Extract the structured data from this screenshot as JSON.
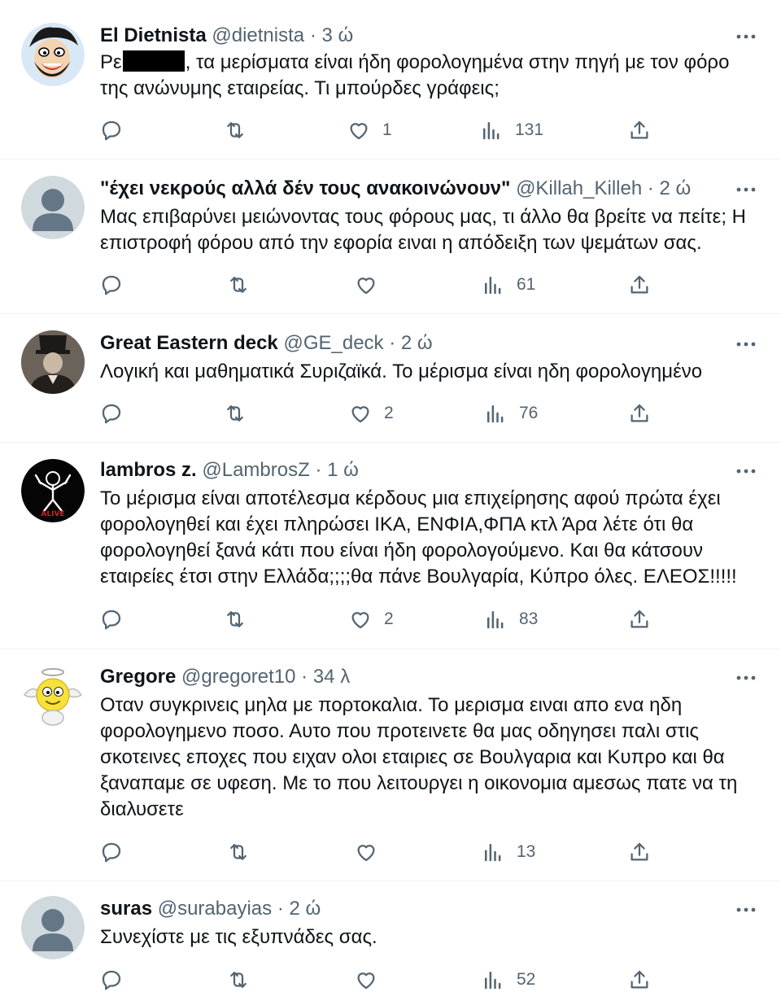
{
  "tweets": [
    {
      "name": "El Dietnista",
      "handle": "@dietnista",
      "time": "· 3 ώ",
      "text_before": "Ρε",
      "text_after": ", τα μερίσματα είναι ήδη φορολογημένα στην πηγή με τον φόρο της ανώνυμης εταιρείας. Τι μπούρδες γράφεις;",
      "likes": "1",
      "views": "131"
    },
    {
      "name": "\"έχει νεκρούς αλλά δέν τους ανακοινώνουν\"",
      "handle": "@Killah_Killeh",
      "time": "· 2 ώ",
      "text": "Μας επιβαρύνει μειώνοντας τους φόρους μας, τι άλλο θα βρείτε να πείτε; Η επιστροφή φόρου από την εφορία ειναι η απόδειξη των ψεμάτων σας.",
      "likes": "",
      "views": "61"
    },
    {
      "name": "Great Eastern deck",
      "handle": "@GE_deck",
      "time": "· 2 ώ",
      "text": "Λογική και μαθηματικά Συριζαϊκά. Το μέρισμα είναι ηδη φορολογημένο",
      "likes": "2",
      "views": "76"
    },
    {
      "name": "lambros z.",
      "handle": "@LambrosZ",
      "time": "· 1 ώ",
      "text": "Το μέρισμα είναι αποτέλεσμα κέρδους μια επιχείρησης αφού πρώτα έχει φορολογηθεί και έχει πληρώσει ΙΚΑ, ΕΝΦΙΑ,ΦΠΑ  κτλ Άρα λέτε ότι θα φορολογηθεί ξανά κάτι που είναι ήδη φορολογούμενο. Και θα κάτσουν εταιρείες έτσι στην Ελλάδα;;;;θα πάνε Βουλγαρία, Κύπρο όλες. ΕΛΕΟΣ!!!!!",
      "likes": "2",
      "views": "83",
      "avatar_text": "ALIVE"
    },
    {
      "name": "Gregore",
      "handle": "@gregoret10",
      "time": "· 34 λ",
      "text": "Οταν συγκρινεις μηλα με πορτοκαλια. Το μερισμα ειναι απο ενα ηδη φορολογημενο ποσο. Αυτο που προτεινετε θα μας οδηγησει παλι στις σκοτεινες εποχες που ειχαν ολοι εταιριες σε Βουλγαρια και Κυπρο και θα ξαναπαμε σε υφεση. Με το που λειτουργει η οικονομια αμεσως πατε να τη διαλυσετε",
      "likes": "",
      "views": "13"
    },
    {
      "name": "suras",
      "handle": "@surabayias",
      "time": "· 2 ώ",
      "text": "Συνεχίστε με τις εξυπνάδες σας.",
      "likes": "",
      "views": "52"
    }
  ],
  "colors": {
    "text": "#0f1419",
    "secondary": "#536471",
    "divider": "#eff3f4"
  },
  "icons": [
    "reply-icon",
    "retweet-icon",
    "like-icon",
    "views-icon",
    "share-icon",
    "more-icon"
  ]
}
